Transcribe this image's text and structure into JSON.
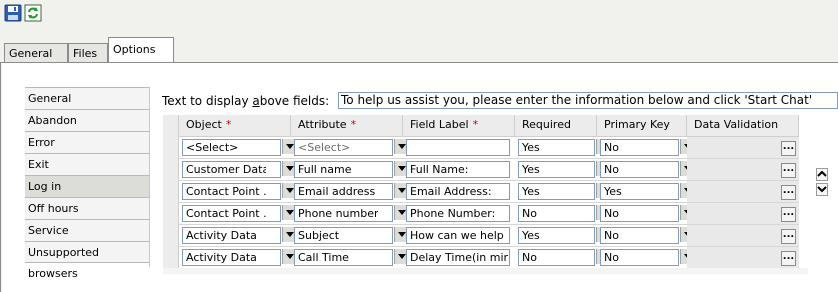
{
  "toolbar": {
    "save_icon": "save-icon",
    "refresh_icon": "refresh-icon"
  },
  "tabs": [
    "General",
    "Files",
    "Options"
  ],
  "active_tab": "Options",
  "nav": {
    "items": [
      "General",
      "Abandon",
      "Error",
      "Exit",
      "Log in",
      "Off hours",
      "Service",
      "Unsupported browsers"
    ],
    "selected": "Log in"
  },
  "display_label": {
    "pre": "Text to display ",
    "accel": "a",
    "post": "bove fields:"
  },
  "display_value": "To help us assist you, please enter the information below and click 'Start Chat'",
  "columns": [
    {
      "label": "Object",
      "required_mark": "*"
    },
    {
      "label": "Attribute",
      "required_mark": "*"
    },
    {
      "label": "Field Label",
      "required_mark": "*"
    },
    {
      "label": "Required",
      "required_mark": ""
    },
    {
      "label": "Primary Key",
      "required_mark": ""
    },
    {
      "label": "Data Validation",
      "required_mark": ""
    }
  ],
  "rows": [
    {
      "object": "<Select>",
      "attribute": "<Select>",
      "field_label": "",
      "required": "Yes",
      "primary_key": "No",
      "validation": "..."
    },
    {
      "object": "Customer Data",
      "attribute": "Full name",
      "field_label": "Full Name:",
      "required": "Yes",
      "primary_key": "No",
      "validation": "..."
    },
    {
      "object": "Contact Point ...",
      "attribute": "Email address",
      "field_label": "Email Address:",
      "required": "Yes",
      "primary_key": "Yes",
      "validation": "..."
    },
    {
      "object": "Contact Point ...",
      "attribute": "Phone number",
      "field_label": "Phone Number:",
      "required": "No",
      "primary_key": "No",
      "validation": "..."
    },
    {
      "object": "Activity Data",
      "attribute": "Subject",
      "field_label": "How can we help ...",
      "required": "Yes",
      "primary_key": "No",
      "validation": "..."
    },
    {
      "object": "Activity Data",
      "attribute": "Call Time",
      "field_label": "Delay Time(in min)",
      "required": "No",
      "primary_key": "No",
      "validation": "..."
    }
  ],
  "colors": {
    "required_star": "#d00000",
    "field_border": "#7f9db9"
  }
}
